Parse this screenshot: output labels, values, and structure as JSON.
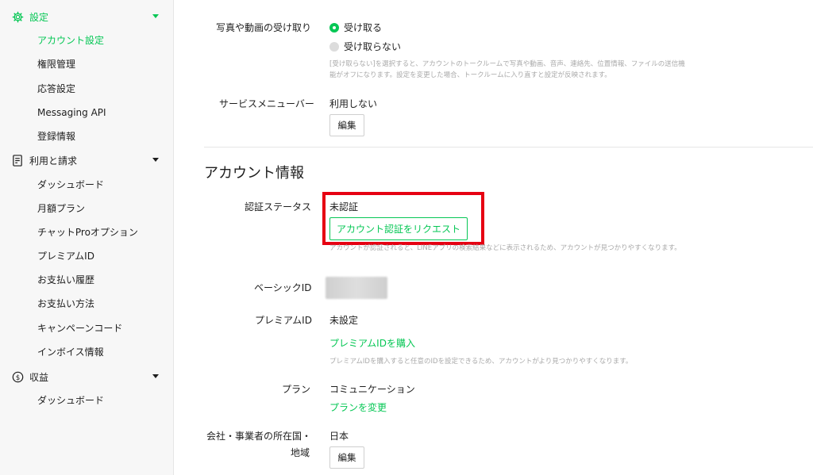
{
  "sidebar": {
    "settings": {
      "label": "設定",
      "items": [
        "アカウント設定",
        "権限管理",
        "応答設定",
        "Messaging API",
        "登録情報"
      ]
    },
    "billing": {
      "label": "利用と請求",
      "items": [
        "ダッシュボード",
        "月額プラン",
        "チャットProオプション",
        "プレミアムID",
        "お支払い履歴",
        "お支払い方法",
        "キャンペーンコード",
        "インボイス情報"
      ]
    },
    "revenue": {
      "label": "収益",
      "items": [
        "ダッシュボード"
      ]
    }
  },
  "media": {
    "label": "写真や動画の受け取り",
    "option_on": "受け取る",
    "option_off": "受け取らない",
    "note": "[受け取らない]を選択すると、アカウントのトークルームで写真や動画、音声、連絡先、位置情報、ファイルの送信機能がオフになります。設定を変更した場合、トークルームに入り直すと設定が反映されます。"
  },
  "service_menu": {
    "label": "サービスメニューバー",
    "value": "利用しない",
    "edit": "編集"
  },
  "account_info": {
    "heading": "アカウント情報",
    "auth_label": "認証ステータス",
    "auth_value": "未認証",
    "auth_button": "アカウント認証をリクエスト",
    "auth_note": "アカウントが認証されると、LINEアプリの検索結果などに表示されるため、アカウントが見つかりやすくなります。",
    "basic_id_label": "ベーシックID",
    "premium_label": "プレミアムID",
    "premium_value": "未設定",
    "premium_link": "プレミアムIDを購入",
    "premium_note": "プレミアムIDを購入すると任意のIDを設定できるため、アカウントがより見つかりやすくなります。",
    "plan_label": "プラン",
    "plan_value": "コミュニケーション",
    "plan_link": "プランを変更",
    "country_label_1": "会社・事業者の所在国・",
    "country_label_2": "地域",
    "country_value": "日本",
    "country_edit": "編集"
  },
  "colors": {
    "accent": "#06c755",
    "highlight": "#e60012"
  }
}
